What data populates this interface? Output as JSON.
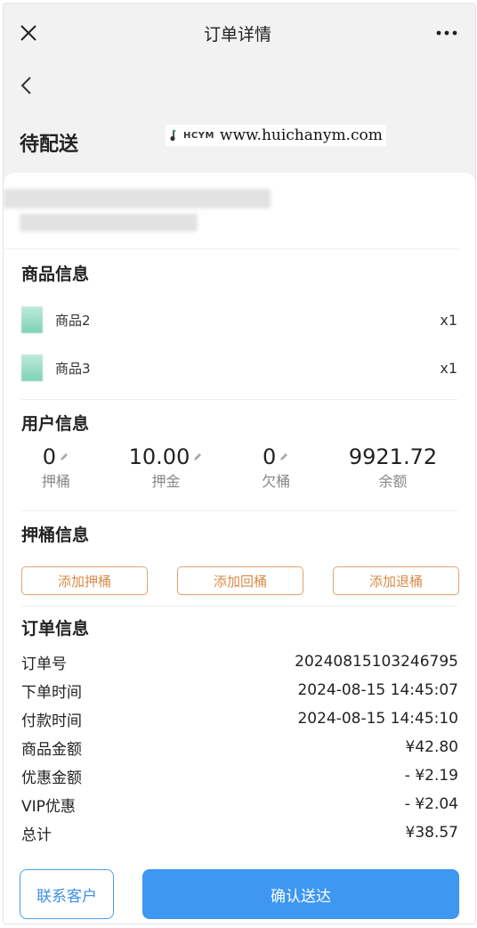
{
  "header": {
    "title": "订单详情"
  },
  "status": {
    "label": "待配送"
  },
  "watermark": {
    "logo": "HCYM",
    "url": "www.huichanym.com"
  },
  "goods": {
    "title": "商品信息",
    "items": [
      {
        "name": "商品2",
        "qty": "x1"
      },
      {
        "name": "商品3",
        "qty": "x1"
      }
    ]
  },
  "user": {
    "title": "用户信息",
    "stats": [
      {
        "value": "0",
        "label": "押桶",
        "editable": true
      },
      {
        "value": "10.00",
        "label": "押金",
        "editable": true
      },
      {
        "value": "0",
        "label": "欠桶",
        "editable": true
      },
      {
        "value": "9921.72",
        "label": "余额",
        "editable": false
      }
    ]
  },
  "bucket": {
    "title": "押桶信息",
    "buttons": [
      "添加押桶",
      "添加回桶",
      "添加退桶"
    ]
  },
  "order": {
    "title": "订单信息",
    "rows": [
      {
        "label": "订单号",
        "value": "20240815103246795"
      },
      {
        "label": "下单时间",
        "value": "2024-08-15 14:45:07"
      },
      {
        "label": "付款时间",
        "value": "2024-08-15 14:45:10"
      },
      {
        "label": "商品金额",
        "value": "¥42.80"
      },
      {
        "label": "优惠金额",
        "value": "- ¥2.19"
      },
      {
        "label": "VIP优惠",
        "value": "- ¥2.04"
      },
      {
        "label": "总计",
        "value": "¥38.57"
      }
    ]
  },
  "actions": {
    "contact": "联系客户",
    "confirm": "确认送达"
  }
}
